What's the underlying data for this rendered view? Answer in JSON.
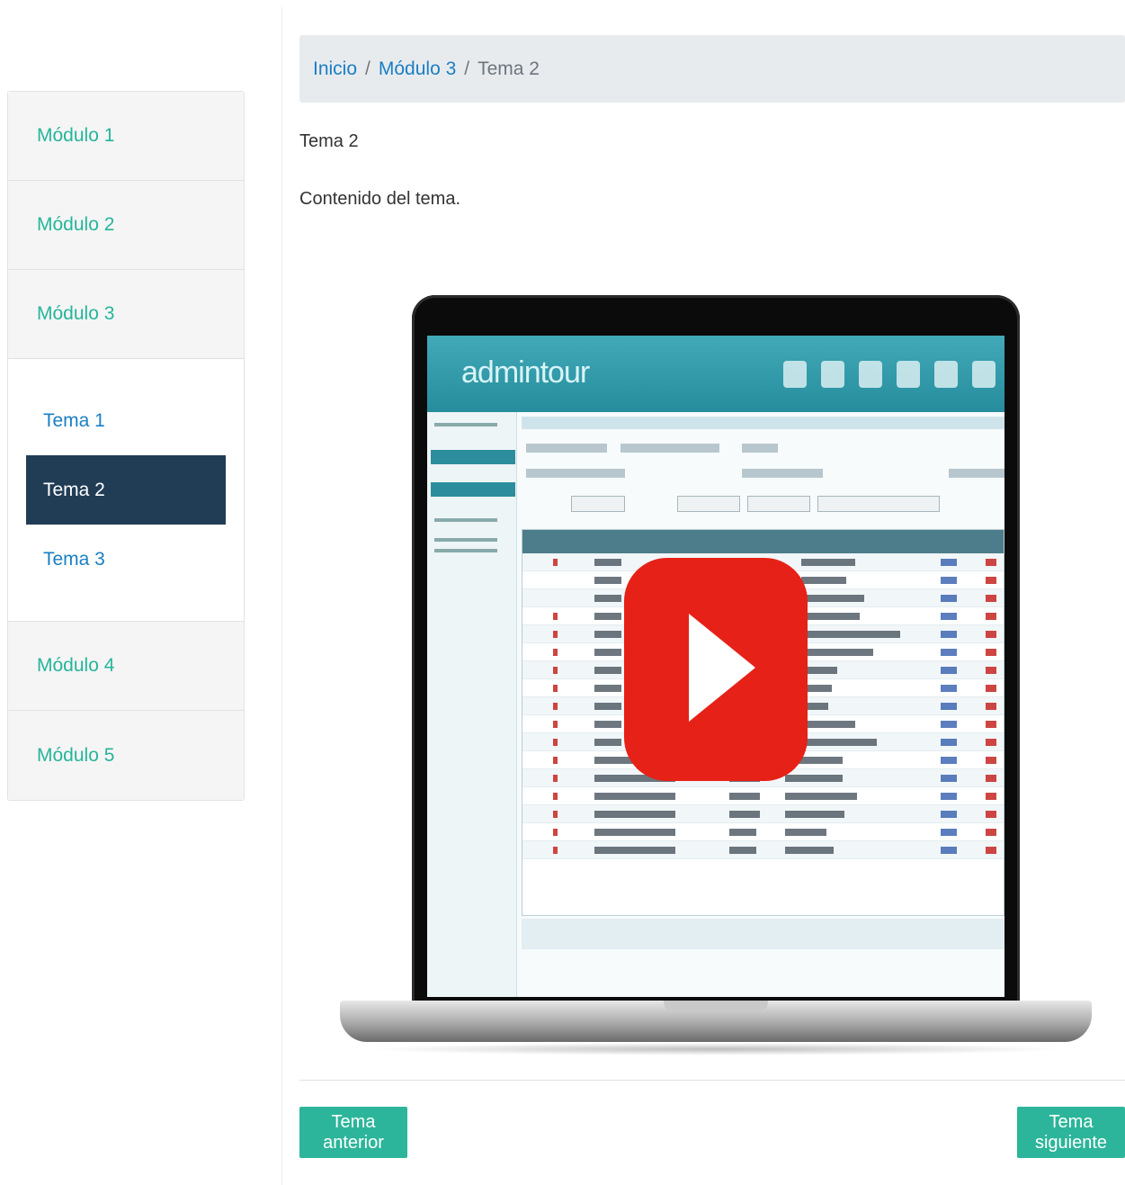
{
  "sidebar": {
    "modules": [
      {
        "label": "Módulo 1"
      },
      {
        "label": "Módulo 2"
      },
      {
        "label": "Módulo 3"
      },
      {
        "label": "Módulo 4"
      },
      {
        "label": "Módulo 5"
      }
    ],
    "topics": [
      {
        "label": "Tema 1"
      },
      {
        "label": "Tema 2",
        "active": true
      },
      {
        "label": "Tema 3"
      }
    ]
  },
  "breadcrumb": {
    "home": "Inicio",
    "module": "Módulo 3",
    "current": "Tema 2",
    "separator": "/"
  },
  "topic": {
    "title": "Tema 2",
    "body": "Contenido del tema."
  },
  "video": {
    "app_logo_text": "admintour",
    "play_icon": "youtube-play-icon"
  },
  "nav": {
    "prev_label": "Tema anterior",
    "next_label": "Tema siguiente"
  },
  "colors": {
    "accent_green": "#2cb59a",
    "link_blue": "#1a7fc4",
    "active_bg": "#213c55",
    "play_red": "#e62117"
  }
}
